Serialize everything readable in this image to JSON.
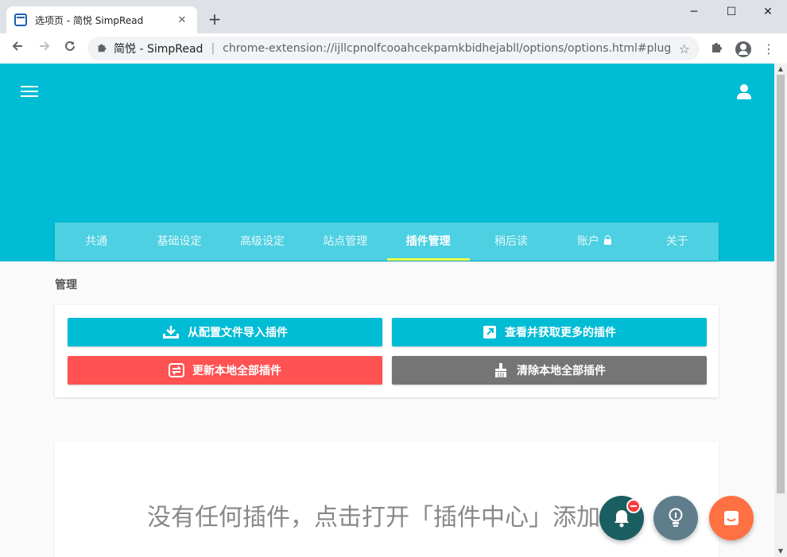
{
  "browser": {
    "tab_title": "选项页 - 简悦 SimpRead",
    "tab_close": "✕",
    "new_tab": "+",
    "win_min": "─",
    "win_max": "☐",
    "win_close": "✕",
    "omnibox_site": "简悦 - SimpRead",
    "omnibox_sep": "|",
    "omnibox_url": "chrome-extension://ijllcpnolfcooahcekpamkbidhejabll/options/options.html#plugins"
  },
  "nav": {
    "tabs": [
      {
        "label": "共通"
      },
      {
        "label": "基础设定"
      },
      {
        "label": "高级设定"
      },
      {
        "label": "站点管理"
      },
      {
        "label": "插件管理"
      },
      {
        "label": "稍后读"
      },
      {
        "label": "账户"
      },
      {
        "label": "关于"
      }
    ],
    "active": "插件管理"
  },
  "manage": {
    "title": "管理",
    "import_label": "从配置文件导入插件",
    "more_label": "查看并获取更多的插件",
    "update_label": "更新本地全部插件",
    "clear_label": "清除本地全部插件"
  },
  "empty": {
    "message": "没有任何插件，点击打开「插件中心」添加"
  },
  "colors": {
    "header": "#00bcd4",
    "tabs_bg": "#4dd0e1",
    "active_indicator": "#eeff41",
    "danger": "#ff5252",
    "neutral": "#757575"
  }
}
